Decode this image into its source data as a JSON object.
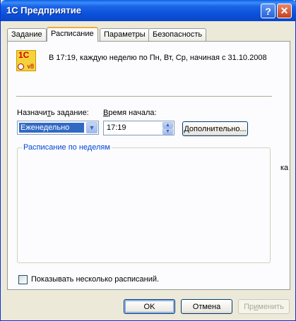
{
  "window": {
    "title": "1С Предприятие",
    "help_glyph": "?",
    "close_glyph": "✕"
  },
  "tabs": [
    {
      "label": "Задание"
    },
    {
      "label": "Расписание"
    },
    {
      "label": "Параметры"
    },
    {
      "label": "Безопасность"
    }
  ],
  "active_tab": "Расписание",
  "logo": {
    "line1": "1С",
    "line2": "v8"
  },
  "schedule": {
    "summary": "В 17:19, каждую неделю по Пн, Вт, Ср, начиная с 31.10.2008",
    "assign_label_pre": "Назначи",
    "assign_label_u": "т",
    "assign_label_post": "ь задание:",
    "assign_value": "Еженедельно",
    "start_label_u": "В",
    "start_label_post": "ремя начала:",
    "start_value": "17:19",
    "more_button": "Дополнительно...",
    "group_title": "Расписание по неделям",
    "clipped_text": "ка",
    "show_multiple_checkbox": "Показывать несколько расписаний."
  },
  "buttons": {
    "ok": "OK",
    "cancel": "Отмена",
    "apply_pre": "Пр",
    "apply_u": "и",
    "apply_post": "менить"
  }
}
